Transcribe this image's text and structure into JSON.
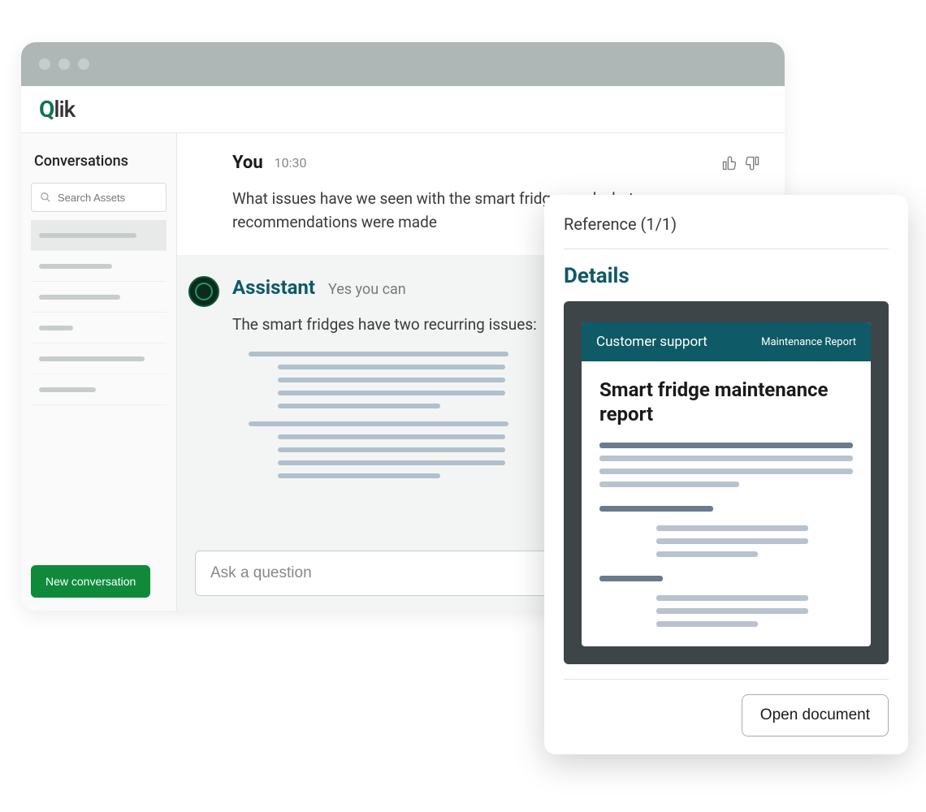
{
  "logo": {
    "q": "Q",
    "lik": "lik"
  },
  "sidebar": {
    "title": "Conversations",
    "search_placeholder": "Search Assets",
    "new_conversation_label": "New conversation"
  },
  "chat": {
    "you": {
      "label": "You",
      "time": "10:30",
      "body": "What issues have we seen with the smart fridges and what recommendations were made"
    },
    "assistant": {
      "label": "Assistant",
      "subtitle": "Yes you can",
      "body": "The smart fridges have two recurring issues:"
    },
    "input_placeholder": "Ask a question"
  },
  "popover": {
    "reference_label": "Reference (1/1)",
    "details_label": "Details",
    "doc": {
      "hdr_left": "Customer support",
      "hdr_right": "Maintenance Report",
      "title": "Smart fridge maintenance report"
    },
    "open_label": "Open document"
  }
}
